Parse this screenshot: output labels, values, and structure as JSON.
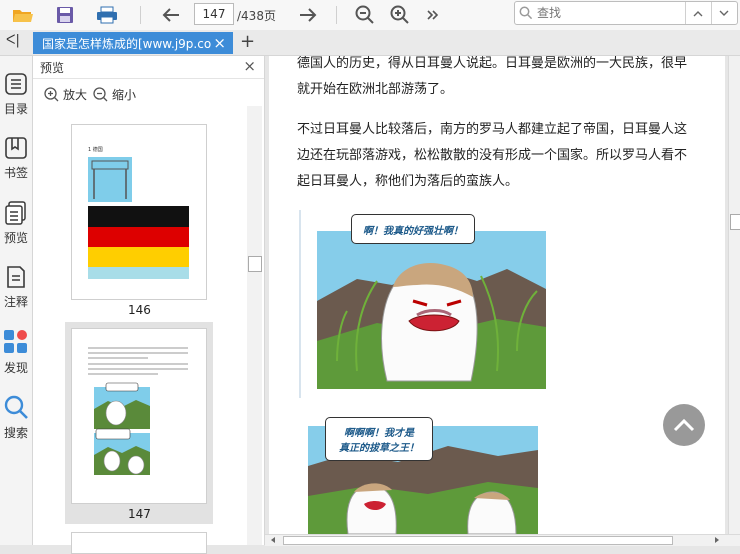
{
  "toolbar": {
    "page_current": "147",
    "page_total": "/438页",
    "search_placeholder": "查找"
  },
  "tabbar": {
    "doc_tab_title": "国家是怎样炼成的[www.j9p.com",
    "close_symbol": "×",
    "add_symbol": "+"
  },
  "rail": {
    "collapse_symbol": "ᐸ|",
    "items": [
      {
        "label": "目录"
      },
      {
        "label": "书签"
      },
      {
        "label": "预览"
      },
      {
        "label": "注释"
      },
      {
        "label": "发现"
      },
      {
        "label": "搜索"
      }
    ]
  },
  "preview": {
    "title": "预览",
    "close_symbol": "×",
    "zoom_in_label": "放大",
    "zoom_out_label": "缩小",
    "thumb1": {
      "number": "146",
      "caption": "1 德国"
    },
    "thumb2": {
      "number": "147"
    }
  },
  "document": {
    "paragraphs": [
      "德国人的历史，得从日耳曼人说起。日耳曼是欧洲的一大民族，很早就开始在欧洲北部游荡了。",
      "不过日耳曼人比较落后，南方的罗马人都建立起了帝国，日耳曼人这边还在玩部落游戏，松松散散的没有形成一个国家。所以罗马人看不起日耳曼人，称他们为落后的蛮族人。"
    ],
    "comic1_bubble": "啊！我真的好强壮啊！",
    "comic2_bubble_line1": "啊啊啊！我才是",
    "comic2_bubble_line2": "真正的拔草之王！"
  },
  "colors": {
    "tab_active": "#3d8cd8",
    "flag_black": "#111111",
    "flag_red": "#dd0000",
    "flag_gold": "#ffce00",
    "sky": "#7fcdea"
  }
}
